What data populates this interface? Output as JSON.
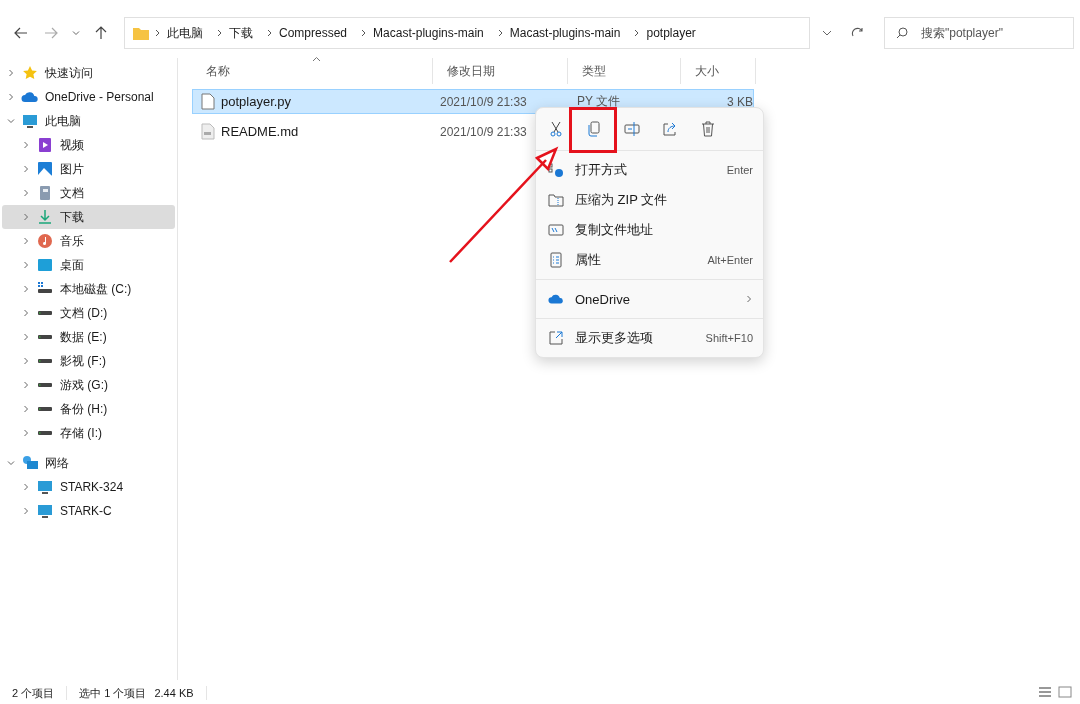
{
  "address_bar": {
    "crumbs": [
      "此电脑",
      "下载",
      "Compressed",
      "Macast-plugins-main",
      "Macast-plugins-main",
      "potplayer"
    ]
  },
  "search": {
    "placeholder": "搜索\"potplayer\""
  },
  "sidebar": {
    "items": [
      {
        "label": "快速访问",
        "kind": "star",
        "expanded": false,
        "selected": false
      },
      {
        "label": "OneDrive - Personal",
        "kind": "cloud",
        "expanded": false,
        "selected": false
      },
      {
        "label": "此电脑",
        "kind": "pc",
        "expanded": true,
        "selected": false,
        "children": [
          {
            "label": "视频",
            "kind": "video",
            "expanded": false,
            "selected": false
          },
          {
            "label": "图片",
            "kind": "pictures",
            "expanded": false,
            "selected": false
          },
          {
            "label": "文档",
            "kind": "document",
            "expanded": false,
            "selected": false
          },
          {
            "label": "下载",
            "kind": "download",
            "expanded": false,
            "selected": true
          },
          {
            "label": "音乐",
            "kind": "music",
            "expanded": false,
            "selected": false
          },
          {
            "label": "桌面",
            "kind": "desktop",
            "expanded": false,
            "selected": false
          },
          {
            "label": "本地磁盘 (C:)",
            "kind": "system-drive",
            "expanded": false,
            "selected": false
          },
          {
            "label": "文档 (D:)",
            "kind": "drive",
            "expanded": false,
            "selected": false
          },
          {
            "label": "数据 (E:)",
            "kind": "drive",
            "expanded": false,
            "selected": false
          },
          {
            "label": "影视 (F:)",
            "kind": "drive",
            "expanded": false,
            "selected": false
          },
          {
            "label": "游戏 (G:)",
            "kind": "drive",
            "expanded": false,
            "selected": false
          },
          {
            "label": "备份 (H:)",
            "kind": "drive",
            "expanded": false,
            "selected": false
          },
          {
            "label": "存储 (I:)",
            "kind": "drive",
            "expanded": false,
            "selected": false
          }
        ]
      },
      {
        "label": "网络",
        "kind": "network",
        "expanded": true,
        "selected": false,
        "children": [
          {
            "label": "STARK-324",
            "kind": "monitor",
            "expanded": false,
            "selected": false
          },
          {
            "label": "STARK-C",
            "kind": "monitor",
            "expanded": false,
            "selected": false
          }
        ]
      }
    ]
  },
  "table": {
    "columns": [
      "名称",
      "修改日期",
      "类型",
      "大小"
    ],
    "rows": [
      {
        "name": "potplayer.py",
        "kind": "text-file",
        "date": "2021/10/9 21:33",
        "type": "PY 文件",
        "size": "3 KB",
        "selected": true
      },
      {
        "name": "README.md",
        "kind": "markdown-file",
        "date": "2021/10/9 21:33",
        "selected": false
      }
    ]
  },
  "context_menu": {
    "items": [
      {
        "label": "打开方式",
        "kind": "open-with",
        "shortcut": "Enter"
      },
      {
        "label": "压缩为 ZIP 文件",
        "kind": "zip"
      },
      {
        "label": "复制文件地址",
        "kind": "copy-path"
      },
      {
        "label": "属性",
        "kind": "properties",
        "shortcut": "Alt+Enter"
      },
      {
        "label": "OneDrive",
        "kind": "onedrive",
        "submenu": true
      },
      {
        "label": "显示更多选项",
        "kind": "more",
        "shortcut": "Shift+F10"
      }
    ]
  },
  "status_bar": {
    "item_count": "2 个项目",
    "selection": "选中 1 个项目",
    "selection_size": "2.44 KB"
  }
}
